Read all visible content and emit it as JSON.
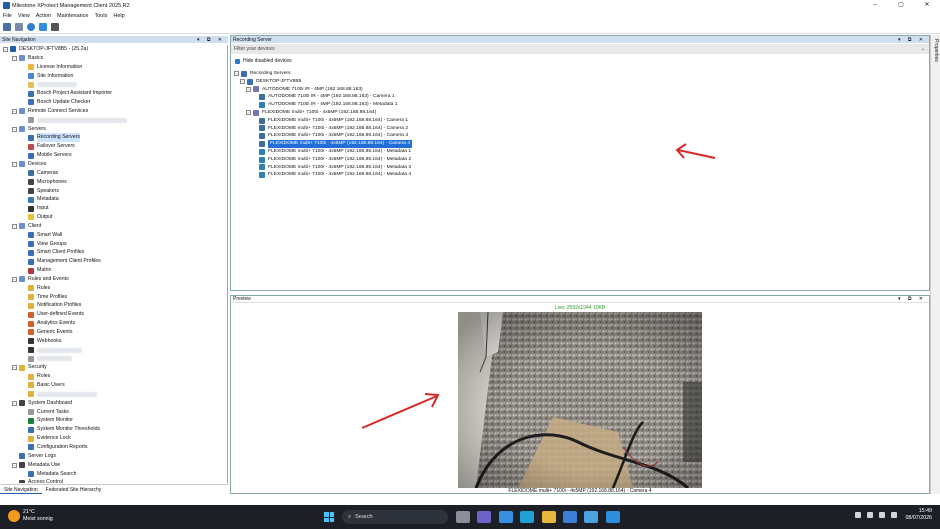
{
  "window": {
    "title": "Milestone XProtect Management Client 2025 R2",
    "controls": [
      "–",
      "▢",
      "✕"
    ]
  },
  "menu": [
    "File",
    "View",
    "Action",
    "Maintenance",
    "Tools",
    "Help"
  ],
  "site_nav": {
    "header": "Site Navigation",
    "controls": "▾ ⧉ ✕",
    "items": [
      {
        "label": "DESKTOP-JFTV8B5 - (25.2a)",
        "level": 0,
        "exp": "−",
        "color": "#1f5fa6"
      },
      {
        "label": "Basics",
        "level": 1,
        "exp": "−",
        "color": "#6b8fc7"
      },
      {
        "label": "License Information",
        "level": 2,
        "color": "#e9b63b"
      },
      {
        "label": "Site Information",
        "level": 2,
        "color": "#4a86c8"
      },
      {
        "label": "",
        "level": 2,
        "color": "#e3c25a",
        "blur": 40
      },
      {
        "label": "Bosch Project Assistant Importer",
        "level": 2,
        "color": "#3c6fb1"
      },
      {
        "label": "Bosch Update Checker",
        "level": 2,
        "color": "#3c6fb1"
      },
      {
        "label": "Remote Connect Services",
        "level": 1,
        "exp": "−",
        "color": "#6b8fc7"
      },
      {
        "label": "",
        "level": 2,
        "color": "#999",
        "blur": 90
      },
      {
        "label": "Servers",
        "level": 1,
        "exp": "−",
        "color": "#6b8fc7"
      },
      {
        "label": "Recording Servers",
        "level": 2,
        "color": "#3c6fb1",
        "selected": true
      },
      {
        "label": "Failover Servers",
        "level": 2,
        "color": "#c04b4b"
      },
      {
        "label": "Mobile Servers",
        "level": 2,
        "color": "#3c6fb1"
      },
      {
        "label": "Devices",
        "level": 1,
        "exp": "−",
        "color": "#6b8fc7"
      },
      {
        "label": "Cameras",
        "level": 2,
        "color": "#3d6e9e"
      },
      {
        "label": "Microphones",
        "level": 2,
        "color": "#444"
      },
      {
        "label": "Speakers",
        "level": 2,
        "color": "#444"
      },
      {
        "label": "Metadata",
        "level": 2,
        "color": "#2f7fb5"
      },
      {
        "label": "Input",
        "level": 2,
        "color": "#333"
      },
      {
        "label": "Output",
        "level": 2,
        "color": "#e6c335"
      },
      {
        "label": "Client",
        "level": 1,
        "exp": "−",
        "color": "#6b8fc7"
      },
      {
        "label": "Smart Wall",
        "level": 2,
        "color": "#3c6fb1"
      },
      {
        "label": "View Groups",
        "level": 2,
        "color": "#3c6fb1"
      },
      {
        "label": "Smart Client Profiles",
        "level": 2,
        "color": "#3c6fb1"
      },
      {
        "label": "Management Client Profiles",
        "level": 2,
        "color": "#3c6fb1"
      },
      {
        "label": "Matrix",
        "level": 2,
        "color": "#b03a3a"
      },
      {
        "label": "Rules and Events",
        "level": 1,
        "exp": "−",
        "color": "#6b8fc7"
      },
      {
        "label": "Rules",
        "level": 2,
        "color": "#e1b23a"
      },
      {
        "label": "Time Profiles",
        "level": 2,
        "color": "#e1b23a"
      },
      {
        "label": "Notification Profiles",
        "level": 2,
        "color": "#e1b23a"
      },
      {
        "label": "User-defined Events",
        "level": 2,
        "color": "#d06030"
      },
      {
        "label": "Analytics Events",
        "level": 2,
        "color": "#d06030"
      },
      {
        "label": "Generic Events",
        "level": 2,
        "color": "#d06030"
      },
      {
        "label": "Webhooks",
        "level": 2,
        "color": "#333"
      },
      {
        "label": "",
        "level": 2,
        "color": "#333",
        "blur": 45
      },
      {
        "label": "",
        "level": 2,
        "color": "#999",
        "blur": 35
      },
      {
        "label": "Security",
        "level": 1,
        "exp": "−",
        "color": "#e1b23a"
      },
      {
        "label": "Roles",
        "level": 2,
        "color": "#e1b23a"
      },
      {
        "label": "Basic Users",
        "level": 2,
        "color": "#e1b23a"
      },
      {
        "label": "",
        "level": 2,
        "color": "#e1b23a",
        "blur": 60
      },
      {
        "label": "System Dashboard",
        "level": 1,
        "exp": "−",
        "color": "#444"
      },
      {
        "label": "Current Tasks",
        "level": 2,
        "color": "#999"
      },
      {
        "label": "System Monitor",
        "level": 2,
        "color": "#1e7f3a"
      },
      {
        "label": "System Monitor Thresholds",
        "level": 2,
        "color": "#3c6fb1"
      },
      {
        "label": "Evidence Lock",
        "level": 2,
        "color": "#e1b23a"
      },
      {
        "label": "Configuration Reports",
        "level": 2,
        "color": "#3c6fb1"
      },
      {
        "label": "Server Logs",
        "level": 1,
        "color": "#3c6fb1"
      },
      {
        "label": "Metadata Use",
        "level": 1,
        "exp": "−",
        "color": "#444"
      },
      {
        "label": "Metadata Search",
        "level": 2,
        "color": "#3c6fb1"
      },
      {
        "label": "Access Control",
        "level": 1,
        "color": "#444"
      }
    ],
    "tabs": [
      "Site Navigation",
      "Federated Site Hierarchy"
    ]
  },
  "recording_server": {
    "header": "Recording Server",
    "controls": "▾ ⧉ ✕",
    "filter_placeholder": "Filter your devices",
    "hide_disabled_label": "Hide disabled devices",
    "tree": [
      {
        "label": "Recording Servers",
        "level": 0,
        "exp": "−",
        "color": "#3c6fb1"
      },
      {
        "label": "DESKTOP-JFTV8B5",
        "level": 1,
        "exp": "−",
        "color": "#3c6fb1"
      },
      {
        "label": "AUTODOME 7100i IR - 4MP (192.168.88.163)",
        "level": 2,
        "exp": "−",
        "color": "#6e7ab8"
      },
      {
        "label": "AUTODOME 7100i IR - 4MP (192.168.88.163) - Camera 1",
        "level": 3,
        "color": "#3d6e9e"
      },
      {
        "label": "AUTODOME 7100i IR - 4MP (192.168.88.163) - Metadata 1",
        "level": 3,
        "color": "#2f7fb5"
      },
      {
        "label": "FLEXIDOME multi+ 7100i - 4x5MP (192.168.88.164)",
        "level": 2,
        "exp": "−",
        "color": "#6e7ab8"
      },
      {
        "label": "FLEXIDOME multi+ 7100i - 4x5MP (192.168.88.164) - Camera 1",
        "level": 3,
        "color": "#3d6e9e"
      },
      {
        "label": "FLEXIDOME multi+ 7100i - 4x5MP (192.168.88.164) - Camera 2",
        "level": 3,
        "color": "#3d6e9e"
      },
      {
        "label": "FLEXIDOME multi+ 7100i - 4x5MP (192.168.88.164) - Camera 3",
        "level": 3,
        "color": "#3d6e9e"
      },
      {
        "label": "FLEXIDOME multi+ 7100i - 4x5MP (192.168.88.164) - Camera 4",
        "level": 3,
        "color": "#3d6e9e",
        "selected": true
      },
      {
        "label": "FLEXIDOME multi+ 7100i - 4x5MP (192.168.88.164) - Metadata 1",
        "level": 3,
        "color": "#2f7fb5"
      },
      {
        "label": "FLEXIDOME multi+ 7100i - 4x5MP (192.168.88.164) - Metadata 2",
        "level": 3,
        "color": "#2f7fb5"
      },
      {
        "label": "FLEXIDOME multi+ 7100i - 4x5MP (192.168.88.164) - Metadata 3",
        "level": 3,
        "color": "#2f7fb5"
      },
      {
        "label": "FLEXIDOME multi+ 7100i - 4x5MP (192.168.88.164) - Metadata 4",
        "level": 3,
        "color": "#2f7fb5"
      }
    ]
  },
  "preview": {
    "header": "Preview",
    "controls": "▾ ⧉ ✕",
    "live_text": "Live: 2592x1944 10KB",
    "caption": "FLEXIDOME multi+ 7100i - 4x5MP (192.168.88.164) - Camera 4"
  },
  "properties": {
    "label": "Properties"
  },
  "taskbar": {
    "temp": "21°C",
    "weather": "Meist sonnig",
    "search_placeholder": "Search",
    "time": "15:49",
    "date": "08/07/2026",
    "apps": [
      {
        "name": "task-view-icon",
        "color": "#8a8f99"
      },
      {
        "name": "teams-icon",
        "color": "#6b63c9"
      },
      {
        "name": "copilot-icon",
        "color": "#3a8fe0"
      },
      {
        "name": "edge-icon",
        "color": "#1fa1d6"
      },
      {
        "name": "explorer-icon",
        "color": "#e8b83a"
      },
      {
        "name": "store-icon",
        "color": "#3a7fd4"
      },
      {
        "name": "xprotect-icon",
        "color": "#4aa3e0"
      },
      {
        "name": "xprotect-client-icon",
        "color": "#2f8fdc"
      }
    ]
  },
  "annotation_color": "#d42a2a"
}
